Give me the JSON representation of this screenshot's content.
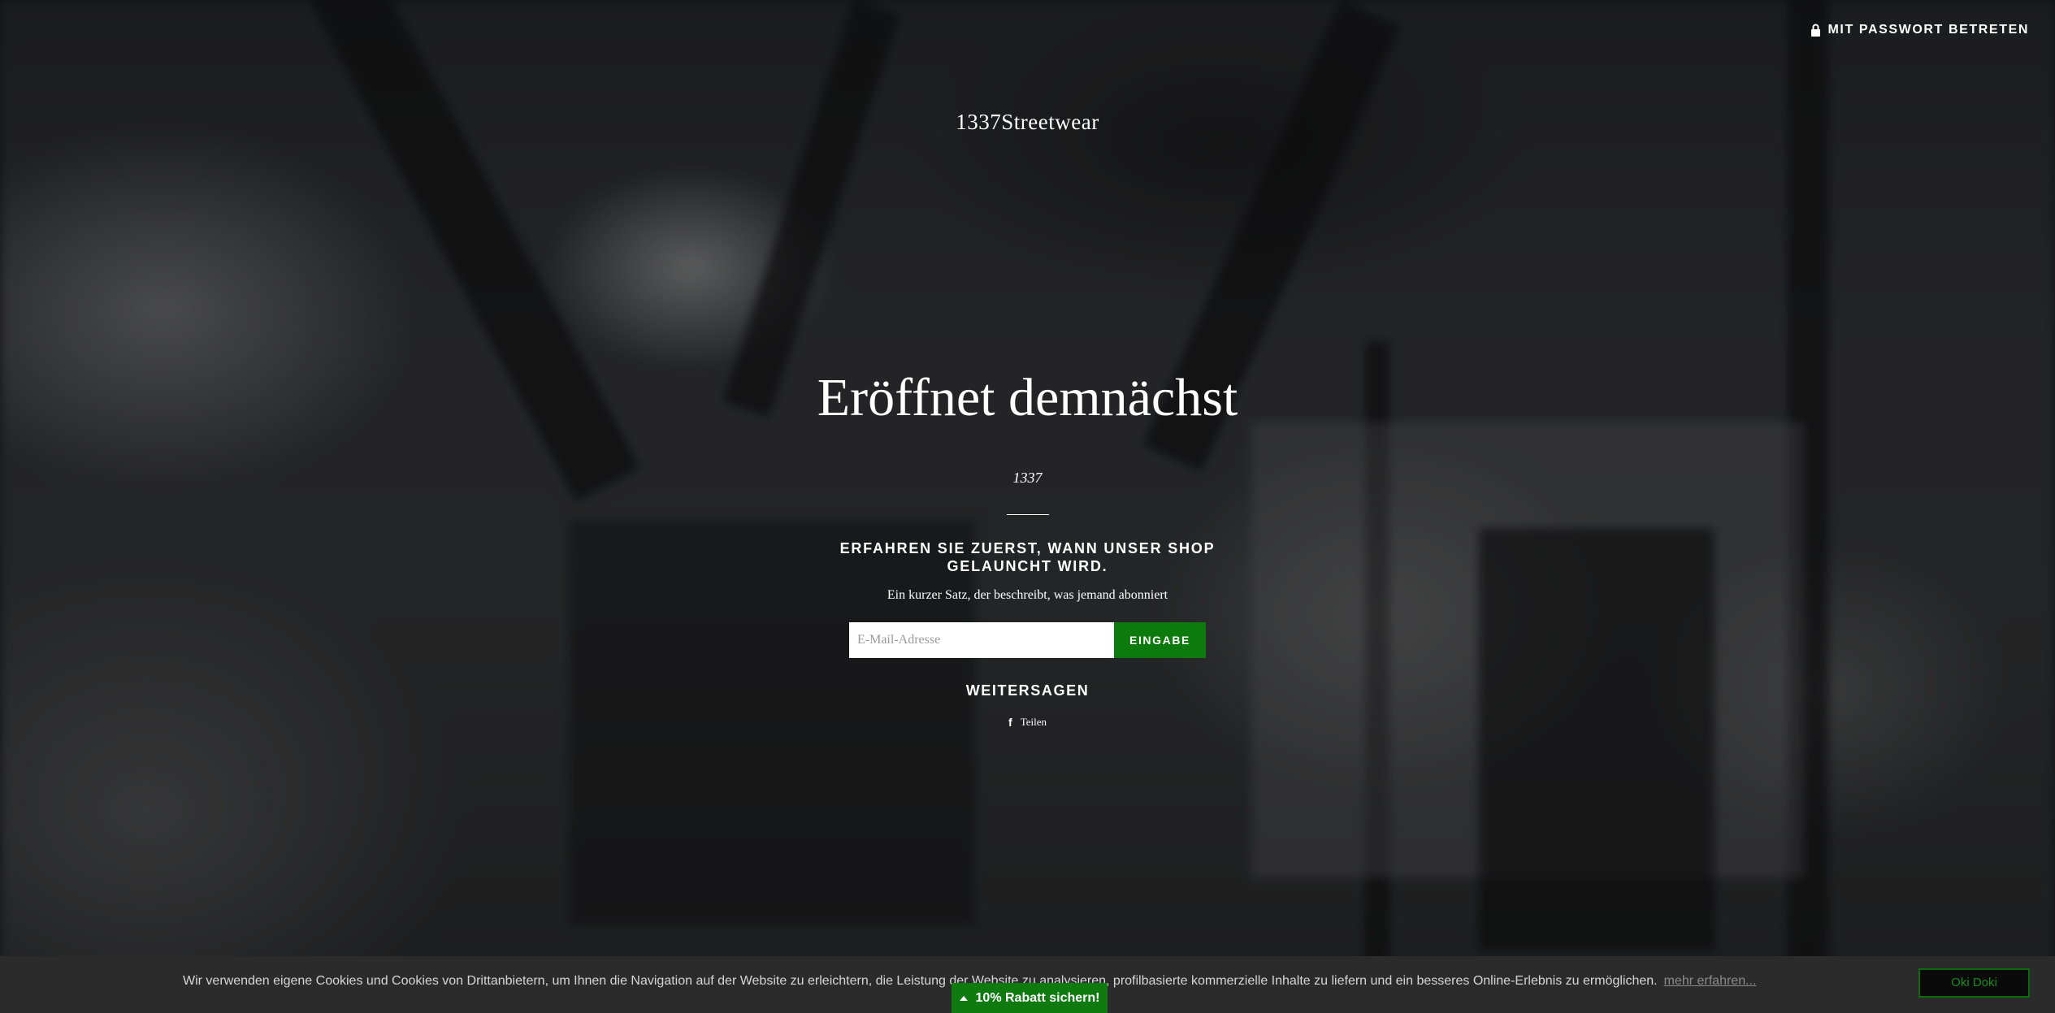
{
  "header": {
    "password_link": "MIT PASSWORT BETRETEN",
    "password_icon": "lock-icon"
  },
  "logo": {
    "text": "1337Streetwear"
  },
  "hero": {
    "headline": "Eröffnet demnächst",
    "subline": "1337"
  },
  "signup": {
    "title": "ERFAHREN SIE ZUERST, WANN UNSER SHOP GELAUNCHT WIRD.",
    "description": "Ein kurzer Satz, der beschreibt, was jemand abonniert",
    "email_placeholder": "E-Mail-Adresse",
    "email_value": "",
    "submit_label": "EINGABE"
  },
  "share": {
    "title": "WEITERSAGEN",
    "facebook_label": "Teilen",
    "facebook_icon": "facebook-icon"
  },
  "cookie_bar": {
    "text": "Wir verwenden eigene Cookies und Cookies von Drittanbietern, um Ihnen die Navigation auf der Website zu erleichtern, die Leistung der Website zu analysieren, profilbasierte kommerzielle Inhalte zu liefern und ein besseres Online-Erlebnis zu ermöglichen.",
    "more_label": "mehr erfahren...",
    "ok_label": "Oki Doki"
  },
  "discount_tab": {
    "label": "10% Rabatt sichern!",
    "icon": "caret-up-icon"
  },
  "colors": {
    "accent_green": "#0d7a0d",
    "cookie_bar_bg": "#2b2b2b",
    "text_white": "#ffffff"
  }
}
